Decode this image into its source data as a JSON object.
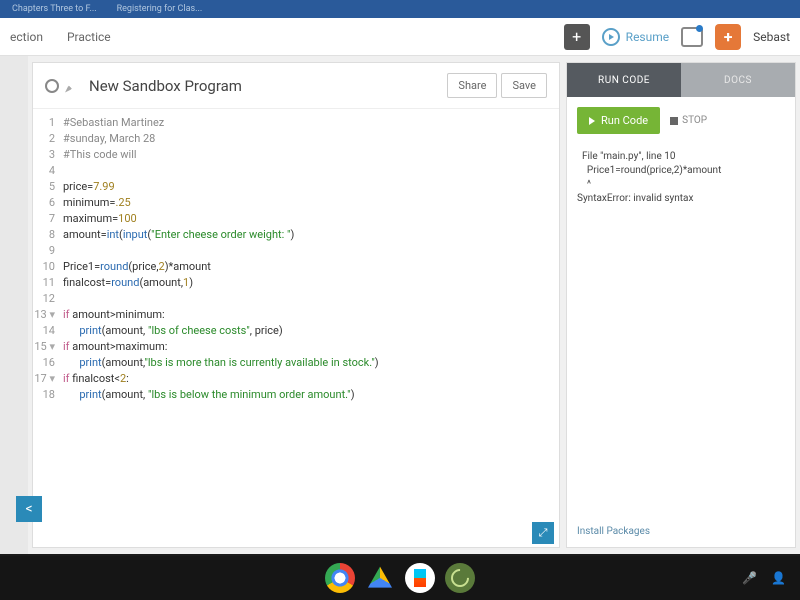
{
  "browser_tabs": [
    "Chapters Three to F...",
    "Registering for Clas..."
  ],
  "nav": {
    "section": "ection",
    "practice": "Practice",
    "resume": "Resume",
    "user": "Sebast"
  },
  "editor": {
    "title": "New Sandbox Program",
    "share": "Share",
    "save": "Save",
    "lines": [
      {
        "n": "1",
        "seg": [
          {
            "cls": "c-comment",
            "t": "#Sebastian Martinez"
          }
        ]
      },
      {
        "n": "2",
        "seg": [
          {
            "cls": "c-comment",
            "t": "#sunday, March 28"
          }
        ]
      },
      {
        "n": "3",
        "seg": [
          {
            "cls": "c-comment",
            "t": "#This code will"
          }
        ]
      },
      {
        "n": "4",
        "seg": []
      },
      {
        "n": "5",
        "seg": [
          {
            "cls": "",
            "t": "price="
          },
          {
            "cls": "c-num",
            "t": "7.99"
          }
        ]
      },
      {
        "n": "6",
        "seg": [
          {
            "cls": "",
            "t": "minimum="
          },
          {
            "cls": "c-num",
            "t": ".25"
          }
        ]
      },
      {
        "n": "7",
        "seg": [
          {
            "cls": "",
            "t": "maximum="
          },
          {
            "cls": "c-num",
            "t": "100"
          }
        ]
      },
      {
        "n": "8",
        "seg": [
          {
            "cls": "",
            "t": "amount="
          },
          {
            "cls": "c-fn",
            "t": "int"
          },
          {
            "cls": "",
            "t": "("
          },
          {
            "cls": "c-fn",
            "t": "input"
          },
          {
            "cls": "",
            "t": "("
          },
          {
            "cls": "c-str",
            "t": "\"Enter cheese order weight: \""
          },
          {
            "cls": "",
            "t": ")"
          }
        ]
      },
      {
        "n": "9",
        "seg": []
      },
      {
        "n": "10",
        "seg": [
          {
            "cls": "",
            "t": "Price1="
          },
          {
            "cls": "c-fn",
            "t": "round"
          },
          {
            "cls": "",
            "t": "(price,"
          },
          {
            "cls": "c-num",
            "t": "2"
          },
          {
            "cls": "",
            "t": ")*amount"
          }
        ]
      },
      {
        "n": "11",
        "seg": [
          {
            "cls": "",
            "t": "finalcost="
          },
          {
            "cls": "c-fn",
            "t": "round"
          },
          {
            "cls": "",
            "t": "(amount,"
          },
          {
            "cls": "c-num",
            "t": "1"
          },
          {
            "cls": "",
            "t": ")"
          }
        ]
      },
      {
        "n": "12",
        "seg": []
      },
      {
        "n": "13",
        "fold": true,
        "seg": [
          {
            "cls": "c-kw",
            "t": "if"
          },
          {
            "cls": "",
            "t": " amount>minimum:"
          }
        ]
      },
      {
        "n": "14",
        "seg": [
          {
            "cls": "",
            "t": "      "
          },
          {
            "cls": "c-fn",
            "t": "print"
          },
          {
            "cls": "",
            "t": "(amount, "
          },
          {
            "cls": "c-str",
            "t": "\"lbs of cheese costs\""
          },
          {
            "cls": "",
            "t": ", price)"
          }
        ]
      },
      {
        "n": "15",
        "fold": true,
        "seg": [
          {
            "cls": "c-kw",
            "t": "if"
          },
          {
            "cls": "",
            "t": " amount>maximum:"
          }
        ]
      },
      {
        "n": "16",
        "seg": [
          {
            "cls": "",
            "t": "      "
          },
          {
            "cls": "c-fn",
            "t": "print"
          },
          {
            "cls": "",
            "t": "(amount,"
          },
          {
            "cls": "c-str",
            "t": "\"lbs is more than is currently available in stock.\""
          },
          {
            "cls": "",
            "t": ")"
          }
        ]
      },
      {
        "n": "17",
        "fold": true,
        "seg": [
          {
            "cls": "c-kw",
            "t": "if"
          },
          {
            "cls": "",
            "t": " finalcost<"
          },
          {
            "cls": "c-num",
            "t": "2"
          },
          {
            "cls": "",
            "t": ":"
          }
        ]
      },
      {
        "n": "18",
        "seg": [
          {
            "cls": "",
            "t": "      "
          },
          {
            "cls": "c-fn",
            "t": "print"
          },
          {
            "cls": "",
            "t": "(amount, "
          },
          {
            "cls": "c-str",
            "t": "\"lbs is below the minimum order amount.\""
          },
          {
            "cls": "",
            "t": ")"
          }
        ]
      }
    ]
  },
  "panel": {
    "tab_run": "RUN CODE",
    "tab_docs": "DOCS",
    "run_btn": "Run Code",
    "stop": "STOP",
    "console": [
      "  File \"main.py\", line 10",
      "    Price1=round(price,2)*amount",
      "    ^",
      "SyntaxError: invalid syntax"
    ],
    "install": "Install Packages"
  },
  "controls": {
    "back": "<",
    "expand": "⤢"
  }
}
